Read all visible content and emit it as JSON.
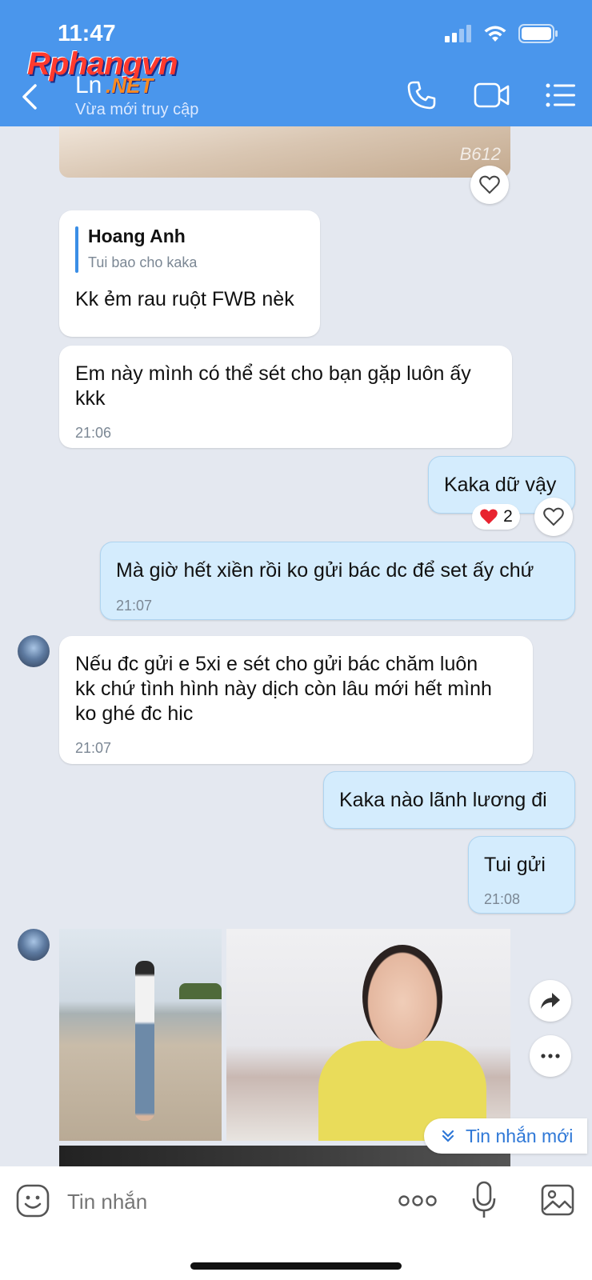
{
  "status_bar": {
    "time": "11:47"
  },
  "watermark": {
    "line1": "Rphangvn",
    "line2": ".NET"
  },
  "header": {
    "contact_name": "Ln",
    "status": "Vừa mới truy cập",
    "back_icon": "chevron-left-icon",
    "call_icon": "phone-icon",
    "video_icon": "video-camera-icon",
    "menu_icon": "list-menu-icon"
  },
  "top_image": {
    "sticker_text": "B612"
  },
  "messages": [
    {
      "side": "left",
      "quote_author": "Hoang Anh",
      "quote_text": "Tui bao cho kaka",
      "text": "Kk ẻm rau ruột FWB nèk"
    },
    {
      "side": "left",
      "text_line1": "Em này mình có thể sét cho bạn gặp luôn ấy",
      "text_line2": "kkk",
      "time": "21:06"
    },
    {
      "side": "right",
      "text": "Kaka dữ vậy",
      "reaction_count": "2"
    },
    {
      "side": "right",
      "text": "Mà giờ hết xiền rồi ko gửi bác dc để set ấy chứ",
      "time": "21:07"
    },
    {
      "side": "left",
      "text_line1": "Nếu đc gửi e 5xi e sét cho gửi bác chăm luôn",
      "text_line2": "kk chứ tình hình này dịch còn lâu mới hết mình",
      "text_line3": "ko ghé đc hic",
      "time": "21:07"
    },
    {
      "side": "right",
      "text": "Kaka nào lãnh lương đi"
    },
    {
      "side": "right",
      "text": "Tui gửi",
      "time": "21:08"
    }
  ],
  "new_messages_pill": "Tin nhắn mới",
  "input": {
    "placeholder": "Tin nhắn"
  },
  "colors": {
    "header": "#4a96ec",
    "my_bubble": "#d4ecfd",
    "background": "#e4e8f0",
    "accent": "#2f78d7"
  }
}
